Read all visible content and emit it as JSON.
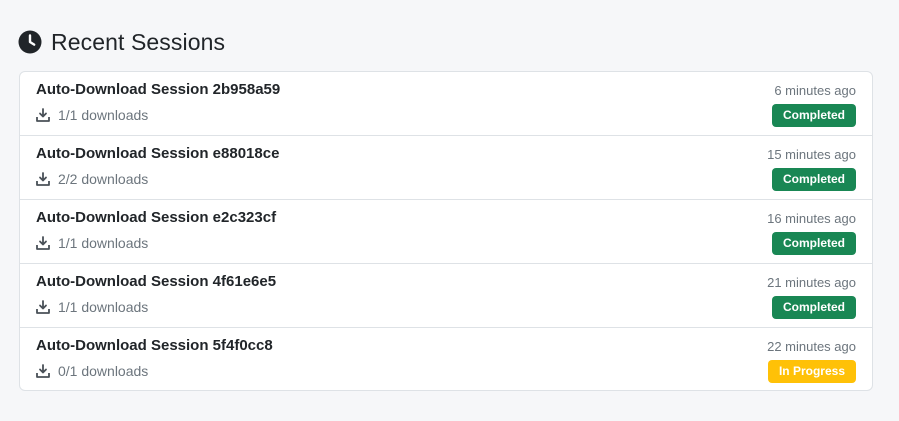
{
  "header": {
    "title": "Recent Sessions",
    "icon": "clock-icon"
  },
  "sessions": [
    {
      "title": "Auto-Download Session 2b958a59",
      "downloads": "1/1 downloads",
      "time": "6 minutes ago",
      "status": "Completed",
      "status_color": "#198754"
    },
    {
      "title": "Auto-Download Session e88018ce",
      "downloads": "2/2 downloads",
      "time": "15 minutes ago",
      "status": "Completed",
      "status_color": "#198754"
    },
    {
      "title": "Auto-Download Session e2c323cf",
      "downloads": "1/1 downloads",
      "time": "16 minutes ago",
      "status": "Completed",
      "status_color": "#198754"
    },
    {
      "title": "Auto-Download Session 4f61e6e5",
      "downloads": "1/1 downloads",
      "time": "21 minutes ago",
      "status": "Completed",
      "status_color": "#198754"
    },
    {
      "title": "Auto-Download Session 5f4f0cc8",
      "downloads": "0/1 downloads",
      "time": "22 minutes ago",
      "status": "In Progress",
      "status_color": "#ffc107"
    }
  ]
}
